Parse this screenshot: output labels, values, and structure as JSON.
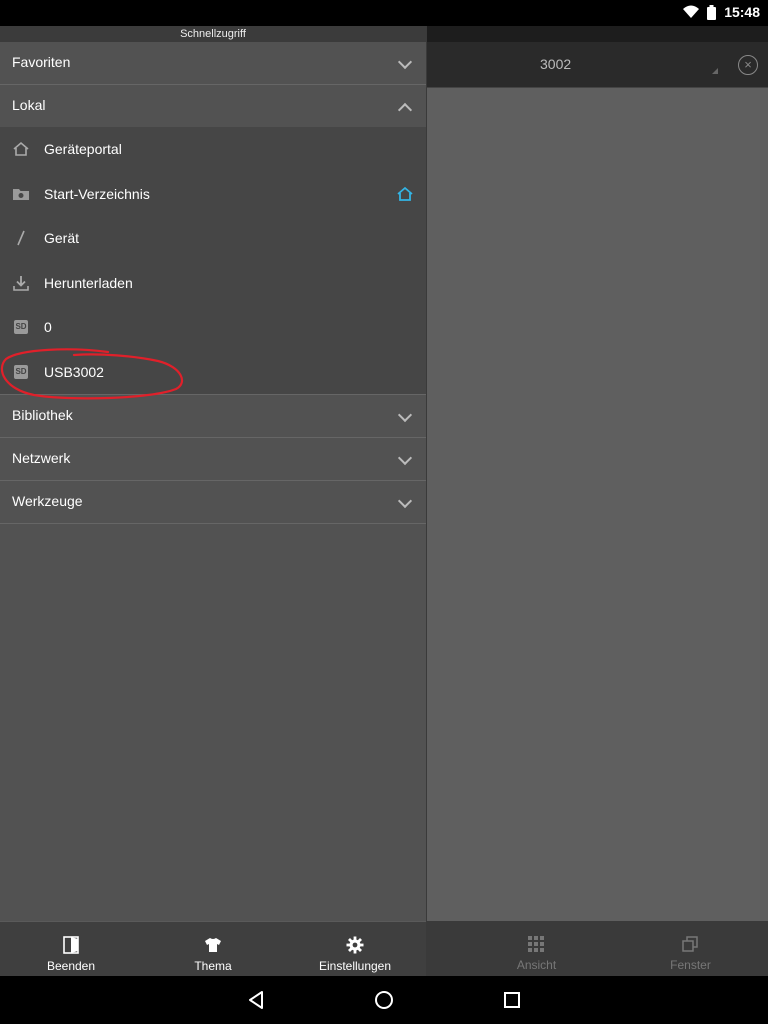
{
  "status": {
    "time": "15:48"
  },
  "drawer": {
    "title": "Schnellzugriff",
    "sections": {
      "favoriten": "Favoriten",
      "lokal": "Lokal",
      "bibliothek": "Bibliothek",
      "netzwerk": "Netzwerk",
      "werkzeuge": "Werkzeuge"
    },
    "lokal_items": [
      {
        "label": "Geräteportal",
        "icon": "house-outline-icon"
      },
      {
        "label": "Start-Verzeichnis",
        "icon": "folder-camera-icon"
      },
      {
        "label": "Gerät",
        "icon": "slash-root-icon"
      },
      {
        "label": "Herunterladen",
        "icon": "download-icon"
      },
      {
        "label": "0",
        "icon": "sd-card-icon"
      },
      {
        "label": "USB3002",
        "icon": "sd-card-icon"
      }
    ],
    "bottom": {
      "beenden": "Beenden",
      "thema": "Thema",
      "einstellungen": "Einstellungen"
    }
  },
  "main": {
    "path": "3002",
    "bottom": {
      "ansicht": "Ansicht",
      "fenster": "Fenster"
    }
  },
  "colors": {
    "accent": "#33b5e5",
    "annotation": "#e0202a"
  }
}
